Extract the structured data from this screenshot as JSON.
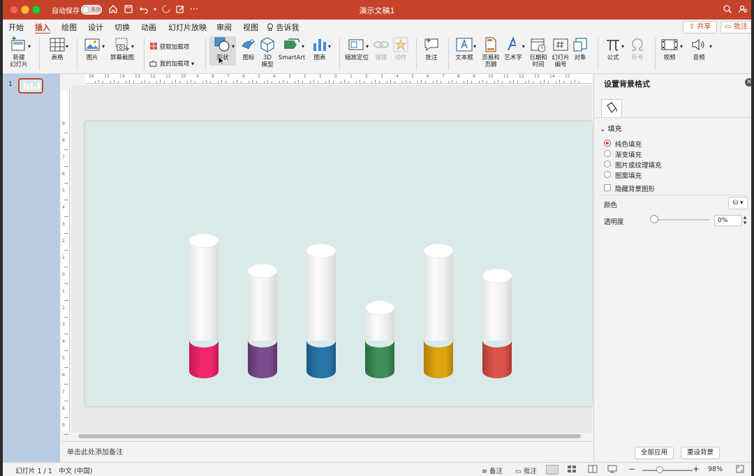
{
  "window": {
    "title": "演示文稿1",
    "autosave_label": "自动保存",
    "autosave_state": "关闭"
  },
  "tabs": [
    "开始",
    "插入",
    "绘图",
    "设计",
    "切换",
    "动画",
    "幻灯片放映",
    "审阅",
    "视图"
  ],
  "active_tab": "插入",
  "tell_me": "告诉我",
  "share_label": "共享",
  "comments_label": "批注",
  "ribbon": {
    "new_slide": "新建\n幻灯片",
    "new_slide_l1": "新建",
    "new_slide_l2": "幻灯片",
    "table": "表格",
    "picture": "图片",
    "screenshot": "屏幕截图",
    "get_addins": "获取加载项",
    "my_addins": "我的加载项",
    "shapes": "形状",
    "icons": "图标",
    "model3d_l1": "3D",
    "model3d_l2": "模型",
    "smartart": "SmartArt",
    "chart": "图表",
    "zoom": "缩放定位",
    "link": "链接",
    "action": "动作",
    "comment": "批注",
    "textbox": "文本框",
    "header_l1": "页眉和",
    "header_l2": "页脚",
    "wordart": "艺术字",
    "datetime_l1": "日期和",
    "datetime_l2": "时间",
    "slidenum_l1": "幻灯片",
    "slidenum_l2": "编号",
    "object": "对象",
    "equation": "公式",
    "symbol": "符号",
    "video": "视频",
    "audio": "音频"
  },
  "thumbnails": {
    "slide_number": "1"
  },
  "ruler_h_labels": [
    "16",
    "15",
    "14",
    "13",
    "12",
    "11",
    "10",
    "9",
    "8",
    "7",
    "6",
    "5",
    "4",
    "3",
    "2",
    "1",
    "0",
    "1",
    "2",
    "3",
    "4",
    "5",
    "6",
    "7",
    "8",
    "9",
    "10",
    "11",
    "12",
    "13",
    "14",
    "15"
  ],
  "ruler_v_labels": [
    "9",
    "8",
    "7",
    "6",
    "5",
    "4",
    "3",
    "2",
    "1",
    "0",
    "1",
    "2",
    "3",
    "4",
    "5",
    "6",
    "7",
    "8",
    "9"
  ],
  "slide": {
    "background": "#daeaea",
    "cylinders": [
      {
        "color": "#f0276b",
        "dark": "#c21a52",
        "level": 0.78
      },
      {
        "color": "#7b4c8c",
        "dark": "#5c346b",
        "level": 0.6
      },
      {
        "color": "#2876a8",
        "dark": "#1b5a83",
        "level": 0.72
      },
      {
        "color": "#3e8f58",
        "dark": "#2b6d40",
        "level": 0.38
      },
      {
        "color": "#dda40f",
        "dark": "#b07f06",
        "level": 0.72
      },
      {
        "color": "#d9554a",
        "dark": "#b03a31",
        "level": 0.57
      }
    ]
  },
  "notes_placeholder": "单击此处添加备注",
  "format_pane": {
    "title": "设置背景格式",
    "section": "填充",
    "fill_options": [
      "纯色填充",
      "渐变填充",
      "图片或纹理填充",
      "图案填充"
    ],
    "selected_fill": "纯色填充",
    "hide_bg_graphics": "隐藏背景图形",
    "color_label": "颜色",
    "transparency_label": "透明度",
    "transparency_value": "0%",
    "apply_all": "全部应用",
    "reset_bg": "重设背景"
  },
  "status": {
    "slide_info": "幻灯片 1 / 1",
    "language": "中文 (中国)",
    "notes": "备注",
    "comments": "批注",
    "zoom": "98%"
  }
}
